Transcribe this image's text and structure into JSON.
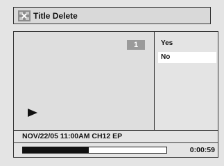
{
  "title_bar": {
    "title": "Title Delete",
    "icon": "title-delete-icon"
  },
  "preview": {
    "title_number": "1",
    "play_icon": "play-icon"
  },
  "menu": {
    "items": [
      {
        "label": "Yes"
      },
      {
        "label": "No"
      }
    ],
    "selected": "No"
  },
  "info": {
    "text": "NOV/22/05 11:00AM CH12 EP"
  },
  "progress": {
    "fraction": 0.46,
    "time": "0:00:59"
  }
}
